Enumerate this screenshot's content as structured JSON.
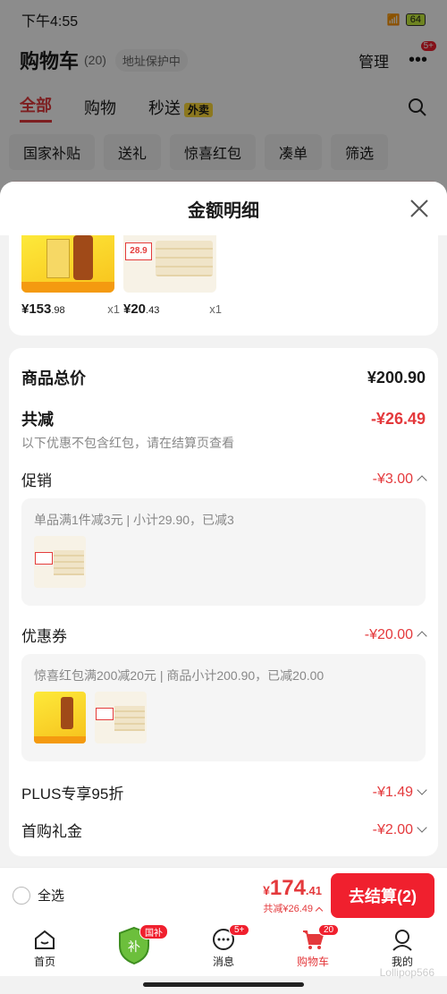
{
  "status_bar": {
    "time": "下午4:55",
    "battery": "64"
  },
  "header": {
    "title": "购物车",
    "count": "(20)",
    "address": "地址保护中",
    "manage": "管理",
    "more_badge": "5+"
  },
  "tabs": [
    {
      "label": "全部",
      "active": true
    },
    {
      "label": "购物"
    },
    {
      "label": "秒送",
      "tag": "外卖"
    }
  ],
  "chips": [
    "国家补贴",
    "送礼",
    "惊喜红包",
    "凑单",
    "筛选"
  ],
  "sheet": {
    "title": "金额明细",
    "items": [
      {
        "price_int": "¥153",
        "price_dec": ".98",
        "qty": "x1"
      },
      {
        "price_int": "¥20",
        "price_dec": ".43",
        "qty": "x1"
      }
    ],
    "total_label": "商品总价",
    "total_value": "¥200.90",
    "reduce_label": "共减",
    "reduce_value": "-¥26.49",
    "note": "以下优惠不包含红包，请在结算页查看",
    "promo": {
      "label": "促销",
      "value": "-¥3.00",
      "desc": "单品满1件减3元 | 小计29.90，已减3"
    },
    "coupon": {
      "label": "优惠券",
      "value": "-¥20.00",
      "desc": "惊喜红包满200减20元 | 商品小计200.90，已减20.00"
    },
    "plus": {
      "label": "PLUS专享95折",
      "value": "-¥1.49"
    },
    "gift": {
      "label": "首购礼金",
      "value": "-¥2.00"
    }
  },
  "checkout": {
    "select_all": "全选",
    "currency": "¥",
    "total_int": "174",
    "total_dec": ".41",
    "saved": "共减¥26.49",
    "button": "去结算(2)"
  },
  "nav": [
    {
      "label": "首页"
    },
    {
      "label": "",
      "badge": "国补"
    },
    {
      "label": "消息",
      "badge": "5+"
    },
    {
      "label": "购物车",
      "badge": "20",
      "active": true
    },
    {
      "label": "我的"
    }
  ],
  "watermark": "Lollipop566",
  "colors": {
    "accent": "#e4393c",
    "button": "#f0202e"
  }
}
